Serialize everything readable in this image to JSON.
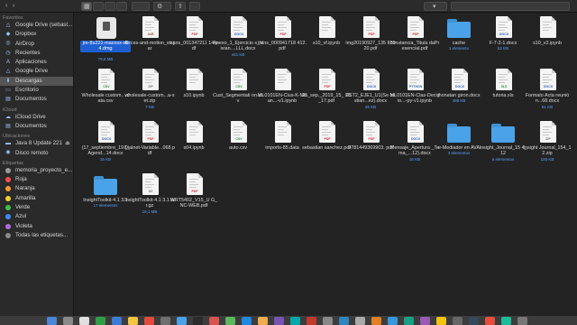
{
  "sidebar": {
    "favorites_title": "Favoritos",
    "favorites": [
      {
        "label": "Google Drive (sebast...",
        "icon": "drive-icon"
      },
      {
        "label": "Dropbox",
        "icon": "dropbox-icon"
      },
      {
        "label": "AirDrop",
        "icon": "airdrop-icon"
      },
      {
        "label": "Recientes",
        "icon": "clock-icon"
      },
      {
        "label": "Aplicaciones",
        "icon": "applications-icon"
      },
      {
        "label": "Google Drive",
        "icon": "drive-icon"
      },
      {
        "label": "Descargas",
        "icon": "downloads-icon"
      },
      {
        "label": "Escritorio",
        "icon": "desktop-icon"
      },
      {
        "label": "Documentos",
        "icon": "documents-icon"
      }
    ],
    "icloud_title": "iCloud",
    "icloud": [
      {
        "label": "iCloud Drive",
        "icon": "cloud-icon"
      },
      {
        "label": "Documentos",
        "icon": "documents-icon"
      }
    ],
    "locations_title": "Ubicaciones",
    "locations": [
      {
        "label": "Java 8 Update 221",
        "icon": "disk-icon",
        "eject": "⏏"
      },
      {
        "label": "Disco remoto",
        "icon": "disc-icon"
      }
    ],
    "tags_title": "Etiquetas",
    "tags": [
      {
        "label": "memoria_proyecto_e...",
        "color": "#9a9a9a"
      },
      {
        "label": "Roja",
        "color": "#ff4b4b"
      },
      {
        "label": "Naranja",
        "color": "#ff9a2e"
      },
      {
        "label": "Amarilla",
        "color": "#f5d12c"
      },
      {
        "label": "Verde",
        "color": "#3cc24a"
      },
      {
        "label": "Azul",
        "color": "#3a8bff"
      },
      {
        "label": "Violeta",
        "color": "#b069e0"
      },
      {
        "label": "Todas las etiquetas...",
        "color": "#8a8a8a"
      }
    ]
  },
  "toolbar": {
    "back": "‹",
    "forward": "›",
    "view_icon": "▦",
    "action_icon": "⚙",
    "share_icon": "⇪",
    "sort_icon": "▾"
  },
  "files": [
    [
      {
        "name": "jre-8u221-macosx-x64.dmg",
        "size": "79,6 MB",
        "kind": "dmg",
        "selected": true
      },
      {
        "name": "forces-and-motion_es.jar",
        "size": "",
        "kind": "doc",
        "tag": "JAR"
      },
      {
        "name": "trans_001347211 14.pdf",
        "size": "",
        "kind": "doc",
        "tag": "PDF"
      },
      {
        "name": "Anexo_1_Ejercicio s_Vivian....LLL.docx",
        "size": "441 KB",
        "kind": "doc",
        "tag": "DOCX"
      },
      {
        "name": "trans_000941718 412.pdf",
        "size": "",
        "kind": "doc",
        "tag": "PDF"
      },
      {
        "name": "s10_vf.ipynb",
        "size": "",
        "kind": "doc",
        "tag": ""
      },
      {
        "name": "img20190927_135 83920.pdf",
        "size": "",
        "kind": "doc",
        "tag": "PDF"
      },
      {
        "name": "constancia_Titula daPresencial.pdf",
        "size": "",
        "kind": "doc",
        "tag": "PDF"
      },
      {
        "name": "cache",
        "size": "1 elemento",
        "kind": "folder"
      },
      {
        "name": "F-7-2-1.docx",
        "size": "52 KB",
        "kind": "doc",
        "tag": "DOCX"
      },
      {
        "name": "s10_v2.ipynb",
        "size": "",
        "kind": "doc",
        "tag": ""
      }
    ],
    [
      {
        "name": "Wholesale custom....data.csv",
        "size": "",
        "kind": "doc",
        "tag": "CSV"
      },
      {
        "name": "wholesale-custom...a-set.zip",
        "size": "7 KB",
        "kind": "doc",
        "tag": "ZIP"
      },
      {
        "name": "s10.ipynb",
        "size": "",
        "kind": "doc",
        "tag": ""
      },
      {
        "name": "Cust_Segmentati on.csv",
        "size": "",
        "kind": "doc",
        "tag": "CSV"
      },
      {
        "name": "ML0101EN-Clus-K-Mean...-v1.ipynb",
        "size": "",
        "kind": "doc",
        "tag": ""
      },
      {
        "name": "25_sep._2019_15_ 26_17.pdf",
        "size": "",
        "kind": "doc",
        "tag": "PDF"
      },
      {
        "name": "EST2_EJE1_U1(Se bastian...ez).docx",
        "size": "25 KB",
        "kind": "doc",
        "tag": "DOCX"
      },
      {
        "name": "ML0101EN-Clas-Decisio...-py-v1.ipynb",
        "size": "",
        "kind": "doc",
        "tag": "PYTHON"
      },
      {
        "name": "jhonatan giron.docx",
        "size": "488 KB",
        "kind": "doc",
        "tag": "DOCX"
      },
      {
        "name": "tutoria.xls",
        "size": "",
        "kind": "doc",
        "tag": "XLS"
      },
      {
        "name": "Formato Acta reunión...68.docx",
        "size": "91 KB",
        "kind": "doc",
        "tag": "DOCX"
      }
    ],
    [
      {
        "name": "(17_septiembre_19 )_Agend...14.docx",
        "size": "15 KB",
        "kind": "doc",
        "tag": "DOCX"
      },
      {
        "name": "Dialnet-Variable...068.pdf",
        "size": "",
        "kind": "doc",
        "tag": "PDF"
      },
      {
        "name": "s04.ipynb",
        "size": "",
        "kind": "doc",
        "tag": ""
      },
      {
        "name": "auto.csv",
        "size": "",
        "kind": "doc",
        "tag": "CSV"
      },
      {
        "name": "imports-85.data",
        "size": "",
        "kind": "doc",
        "tag": ""
      },
      {
        "name": "sebastian sanchez.pdf",
        "size": "",
        "kind": "doc",
        "tag": "PDF"
      },
      {
        "name": "9781449369903. pdf",
        "size": "",
        "kind": "doc",
        "tag": "PDF"
      },
      {
        "name": "Mensaje_Apertura _Tema_...12).docx",
        "size": "16 KB",
        "kind": "doc",
        "tag": "DOCX"
      },
      {
        "name": "e-Mediador en AVA",
        "size": "3 elementos",
        "kind": "folder"
      },
      {
        "name": "Insight_Journal_15 4_12",
        "size": "6 elementos",
        "kind": "folder"
      },
      {
        "name": "Insight Journal_154_12.zip",
        "size": "100 KB",
        "kind": "doc",
        "tag": "ZIP"
      }
    ],
    [
      {
        "name": "InsightToolkit-4.1 3.1",
        "size": "17 elementos",
        "kind": "folder"
      },
      {
        "name": "InsightToolkit-4.1 3.1.tar.gz",
        "size": "19,1 MB",
        "kind": "doc",
        "tag": "GZ"
      },
      {
        "name": "WRT5402_V15_U G_NC-WEB.pdf",
        "size": "",
        "kind": "doc",
        "tag": "PDF"
      }
    ]
  ]
}
